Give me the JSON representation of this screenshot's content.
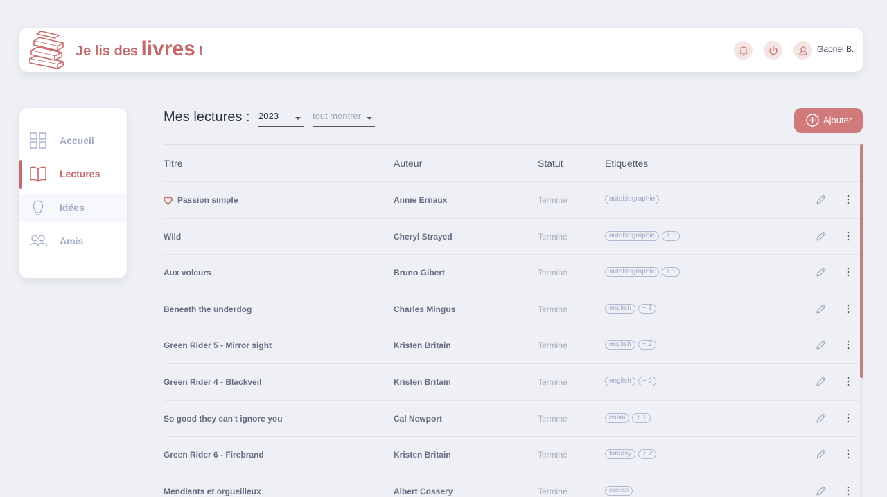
{
  "header": {
    "logo_prefix": "Je lis des",
    "logo_word": "livres",
    "logo_suffix": "!",
    "user_name": "Gabriel B."
  },
  "sidebar": {
    "items": [
      {
        "label": "Accueil",
        "icon": "grid-icon"
      },
      {
        "label": "Lectures",
        "icon": "book-open-icon",
        "active": true
      },
      {
        "label": "Idées",
        "icon": "lightbulb-icon"
      },
      {
        "label": "Amis",
        "icon": "users-icon"
      }
    ]
  },
  "main": {
    "title": "Mes lectures :",
    "year_select": "2023",
    "filter_select": "tout montrer",
    "add_button": "Ajouter"
  },
  "table": {
    "headers": [
      "Titre",
      "Auteur",
      "Statut",
      "Étiquettes"
    ],
    "rows": [
      {
        "title": "Passion simple",
        "author": "Annie Ernaux",
        "status": "Terminé",
        "tag": "autobiographie",
        "extra": "",
        "favorite": true
      },
      {
        "title": "Wild",
        "author": "Cheryl Strayed",
        "status": "Terminé",
        "tag": "autobiographie",
        "extra": "+ 1"
      },
      {
        "title": "Aux voleurs",
        "author": "Bruno Gibert",
        "status": "Terminé",
        "tag": "autobiographie",
        "extra": "+ 1"
      },
      {
        "title": "Beneath the underdog",
        "author": "Charles Mingus",
        "status": "Terminé",
        "tag": "english",
        "extra": "+ 1"
      },
      {
        "title": "Green Rider 5 - Mirror sight",
        "author": "Kristen Britain",
        "status": "Terminé",
        "tag": "english",
        "extra": "+ 2"
      },
      {
        "title": "Green Rider 4 - Blackveil",
        "author": "Kristen Britain",
        "status": "Terminé",
        "tag": "english",
        "extra": "+ 2"
      },
      {
        "title": "So good they can't ignore you",
        "author": "Cal Newport",
        "status": "Terminé",
        "tag": "essai",
        "extra": "+ 1"
      },
      {
        "title": "Green Rider 6 - Firebrand",
        "author": "Kristen Britain",
        "status": "Terminé",
        "tag": "fantasy",
        "extra": "+ 2"
      },
      {
        "title": "Mendiants et orgueilleux",
        "author": "Albert Cossery",
        "status": "Terminé",
        "tag": "roman",
        "extra": ""
      }
    ]
  },
  "colors": {
    "accent": "#c46a6a",
    "button": "#d17a7a",
    "background": "#eef0f5"
  }
}
